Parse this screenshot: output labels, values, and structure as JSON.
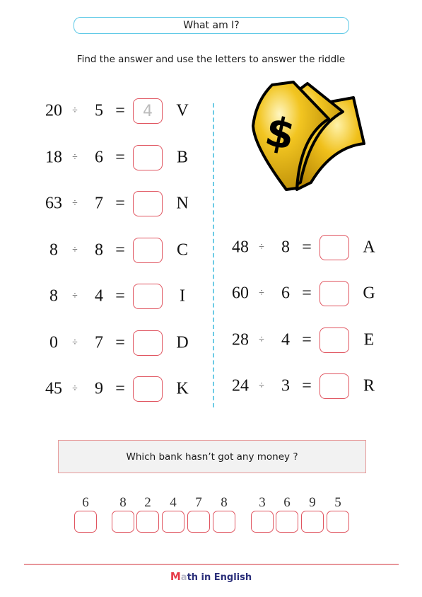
{
  "header": {
    "title": "What am I?",
    "instruction": "Find the answer and use the letters to answer the riddle"
  },
  "operator_symbol": "÷",
  "equals_symbol": "=",
  "left_equations": [
    {
      "dividend": "20",
      "divisor": "5",
      "answer": "4",
      "letter": "V"
    },
    {
      "dividend": "18",
      "divisor": "6",
      "answer": "",
      "letter": "B"
    },
    {
      "dividend": "63",
      "divisor": "7",
      "answer": "",
      "letter": "N"
    },
    {
      "dividend": "8",
      "divisor": "8",
      "answer": "",
      "letter": "C"
    },
    {
      "dividend": "8",
      "divisor": "4",
      "answer": "",
      "letter": "I"
    },
    {
      "dividend": "0",
      "divisor": "7",
      "answer": "",
      "letter": "D"
    },
    {
      "dividend": "45",
      "divisor": "9",
      "answer": "",
      "letter": "K"
    }
  ],
  "right_equations": [
    {
      "dividend": "48",
      "divisor": "8",
      "answer": "",
      "letter": "A"
    },
    {
      "dividend": "60",
      "divisor": "6",
      "answer": "",
      "letter": "G"
    },
    {
      "dividend": "28",
      "divisor": "4",
      "answer": "",
      "letter": "E"
    },
    {
      "dividend": "24",
      "divisor": "3",
      "answer": "",
      "letter": "R"
    }
  ],
  "illustration": {
    "icon": "money-bills-icon",
    "symbol": "$"
  },
  "riddle": {
    "question": "Which bank hasn’t got any money ?",
    "code": [
      {
        "number": "6",
        "answer": ""
      },
      {
        "number": "8",
        "answer": ""
      },
      {
        "number": "2",
        "answer": ""
      },
      {
        "number": "4",
        "answer": ""
      },
      {
        "number": "7",
        "answer": ""
      },
      {
        "number": "8",
        "answer": ""
      },
      {
        "number": "3",
        "answer": ""
      },
      {
        "number": "6",
        "answer": ""
      },
      {
        "number": "9",
        "answer": ""
      },
      {
        "number": "5",
        "answer": ""
      }
    ]
  },
  "footer": {
    "brand_first": "M",
    "brand_second": "a",
    "brand_rest": "th in English"
  },
  "colors": {
    "accent_blue": "#5bc8e6",
    "box_red": "#e05560",
    "brand_red": "#e63946",
    "brand_navy": "#2b2f7a"
  }
}
